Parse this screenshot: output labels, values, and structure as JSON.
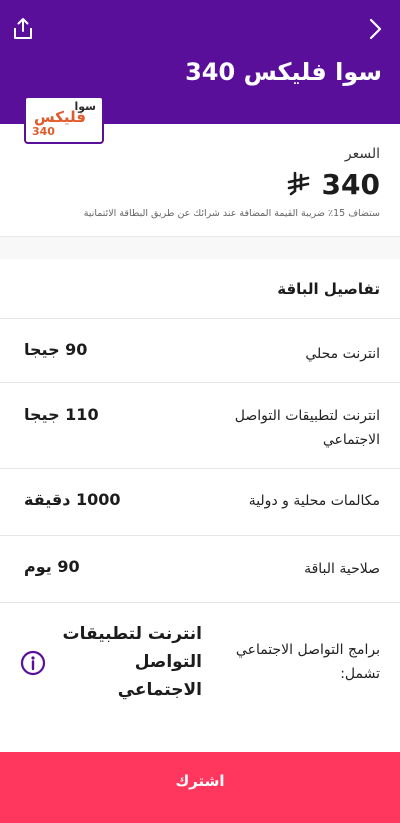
{
  "header": {
    "title": "سوا فليكس 340",
    "share_icon": "share-icon",
    "back_icon": "chevron-right-icon",
    "background": "#5a0f9a"
  },
  "badge": {
    "brand": "سوا",
    "name": "فليكس",
    "number": "340"
  },
  "price": {
    "label": "السعر",
    "value": "340",
    "currency_icon": "saudi-riyal-icon",
    "vat_note": "ستضاف 15٪ ضريبة القيمة المضافة عند شرائك عن طريق البطاقة الائتمانية"
  },
  "details": {
    "title": "تفاصيل الباقة",
    "rows": [
      {
        "label": "انترنت محلي",
        "value": "90 جيجا"
      },
      {
        "label": "انترنت لتطبيقات التواصل الاجتماعي",
        "value": "110 جيجا"
      },
      {
        "label": "مكالمات محلية و دولية",
        "value": "1000 دقيقة"
      },
      {
        "label": "صلاحية الباقة",
        "value": "90 يوم"
      }
    ],
    "social": {
      "label": "برامج التواصل الاجتماعي تشمل:",
      "value": "انترنت لتطبيقات التواصل الاجتماعي",
      "icon": "info-icon"
    }
  },
  "subscribe": {
    "label": "اشترك",
    "color": "#ff375f"
  }
}
